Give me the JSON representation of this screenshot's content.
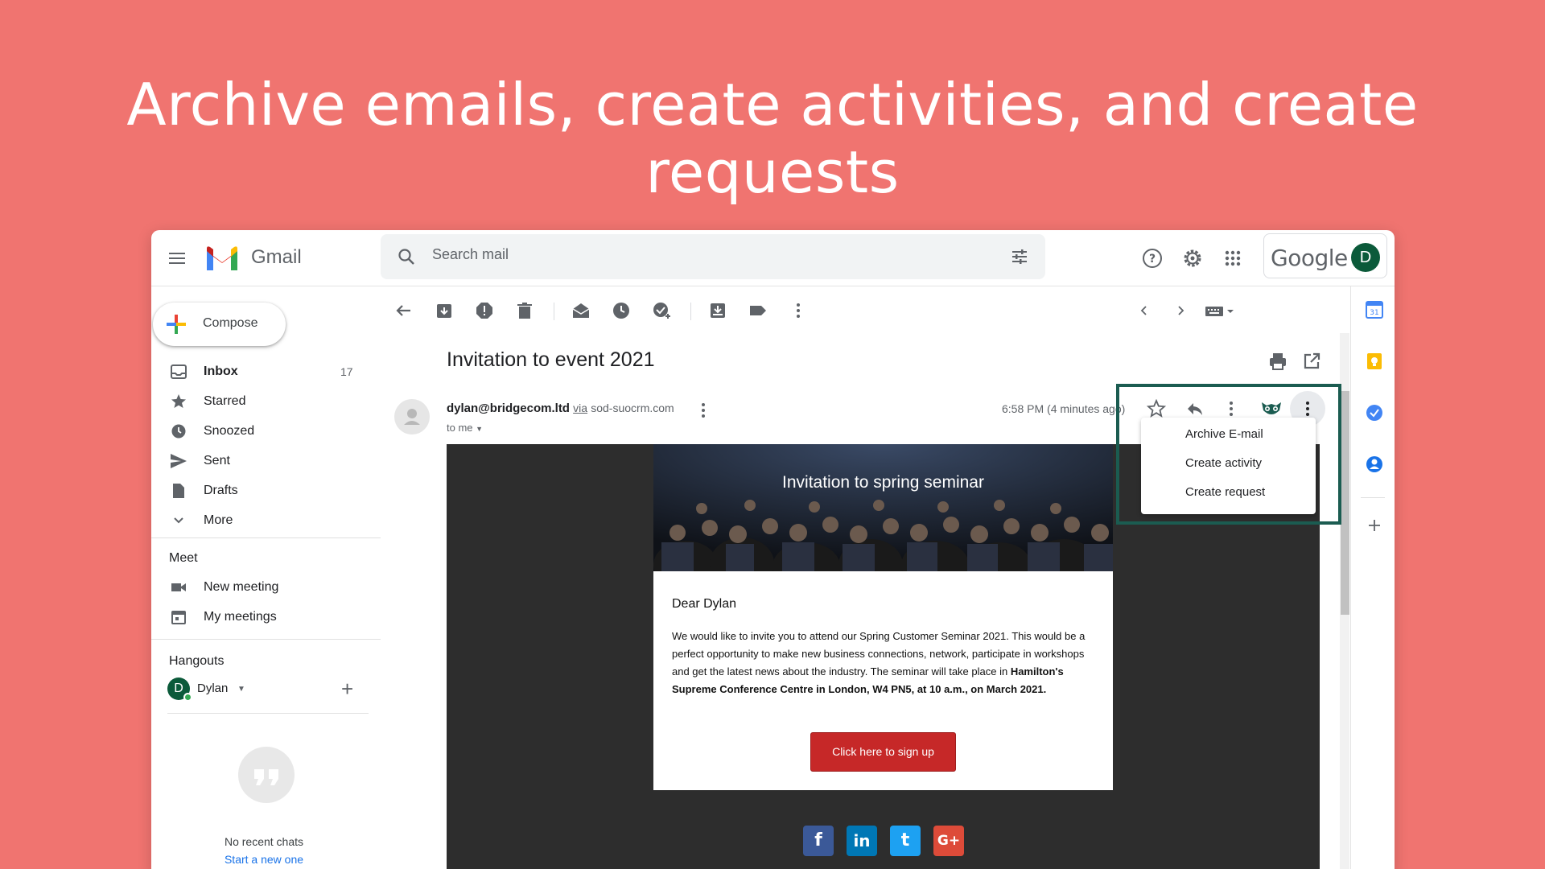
{
  "headline": "Archive emails, create activities, and create requests",
  "header": {
    "app_name": "Gmail",
    "search_placeholder": "Search mail",
    "google_word": "Google",
    "avatar_initial": "D"
  },
  "sidebar": {
    "compose_label": "Compose",
    "items": [
      {
        "label": "Inbox",
        "count": "17",
        "icon": "inbox-icon"
      },
      {
        "label": "Starred",
        "count": "",
        "icon": "star-icon"
      },
      {
        "label": "Snoozed",
        "count": "",
        "icon": "clock-icon"
      },
      {
        "label": "Sent",
        "count": "",
        "icon": "send-icon"
      },
      {
        "label": "Drafts",
        "count": "",
        "icon": "draft-icon"
      },
      {
        "label": "More",
        "count": "",
        "icon": "chevron-down-icon"
      }
    ],
    "meet_title": "Meet",
    "meet_items": [
      {
        "label": "New meeting",
        "icon": "video-icon"
      },
      {
        "label": "My meetings",
        "icon": "calendar-icon"
      }
    ],
    "hangouts_title": "Hangouts",
    "hangouts_user_initial": "D",
    "hangouts_user": "Dylan",
    "no_chats": "No recent chats",
    "start_new": "Start a new one"
  },
  "message": {
    "subject": "Invitation to event 2021",
    "sender_email": "dylan@bridgecom.ltd",
    "via": "via",
    "sender_domain": "sod-suocrm.com",
    "to": "to me",
    "timestamp": "6:58 PM (4 minutes ago)"
  },
  "email_body": {
    "banner_title": "Invitation to spring seminar",
    "greeting": "Dear Dylan",
    "paragraph": "We would like to invite you to attend our Spring Customer Seminar 2021. This would be a perfect opportunity to make new business connections, network, participate in workshops and get the latest news about the industry. The seminar will take place in ",
    "paragraph_bold": "Hamilton's Supreme Conference Centre in London, W4 PN5, at 10 a.m., on March 2021.",
    "cta": "Click here to sign up",
    "social": [
      {
        "name": "facebook-icon",
        "glyph": "f",
        "color": "#3b5998"
      },
      {
        "name": "linkedin-icon",
        "glyph": "in",
        "color": "#0077b5"
      },
      {
        "name": "twitter-icon",
        "glyph": "t",
        "color": "#1da1f2"
      },
      {
        "name": "google-plus-icon",
        "glyph": "G+",
        "color": "#dd4b39"
      }
    ]
  },
  "dropdown": {
    "items": [
      "Archive E-mail",
      "Create activity",
      "Create request"
    ]
  },
  "colors": {
    "background": "#f07470",
    "highlight_border": "#1b5c51",
    "cta": "#c62828",
    "avatar": "#0b5a3a"
  }
}
